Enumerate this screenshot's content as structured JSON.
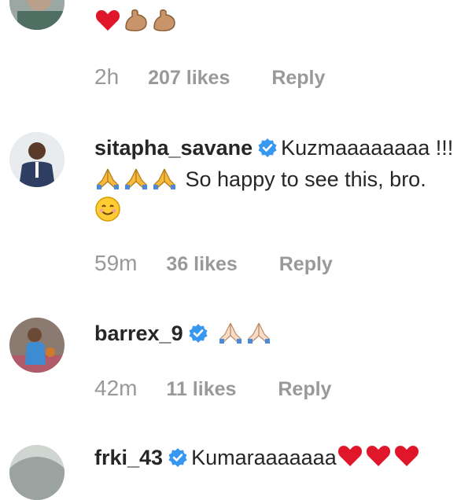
{
  "comments": [
    {
      "text": "",
      "time": "2h",
      "likes": "207 likes",
      "reply": "Reply",
      "emojis": [
        "heart",
        "flexed-biceps",
        "flexed-biceps"
      ]
    },
    {
      "username": "sitapha_savane",
      "text_a": "Kuzmaaaaaaaa !!!",
      "text_b": "So happy to see this, bro.",
      "time": "59m",
      "likes": "36 likes",
      "reply": "Reply",
      "emojis": [
        "folded-hands",
        "folded-hands",
        "folded-hands",
        "smiling-face"
      ]
    },
    {
      "username": "barrex_9",
      "time": "42m",
      "likes": "11 likes",
      "reply": "Reply",
      "emojis": [
        "folded-hands",
        "folded-hands"
      ]
    },
    {
      "username": "frki_43",
      "text": "Kumaraaaaaaa",
      "emojis": [
        "heart",
        "heart",
        "heart"
      ]
    }
  ],
  "colors": {
    "text": "#262626",
    "meta": "#999999",
    "verified": "#3897f0",
    "heart": "#e0162b",
    "skin": "#c8956b",
    "hands_blue": "#f6b93b"
  }
}
